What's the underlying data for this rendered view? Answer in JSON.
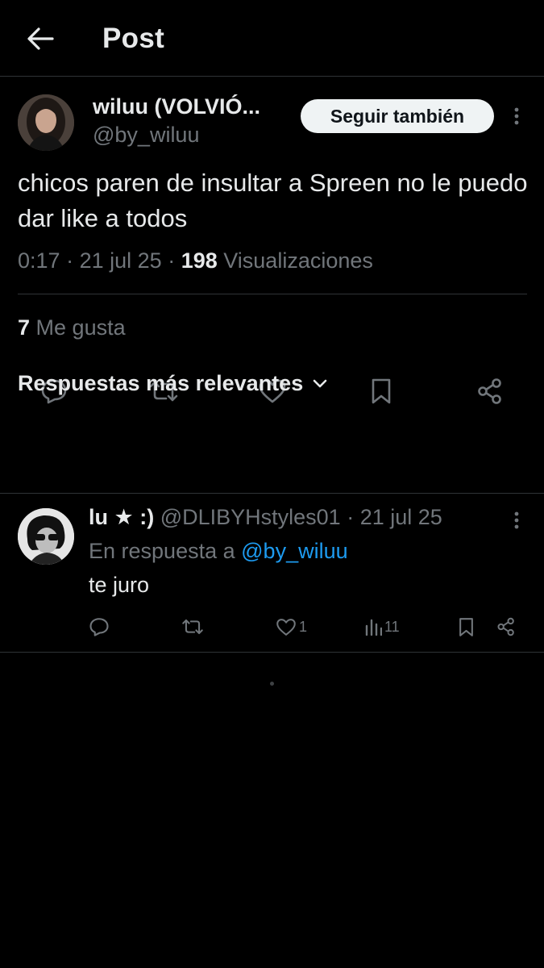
{
  "header": {
    "title": "Post"
  },
  "post": {
    "author_name": "wiluu (VOLVIÓ...",
    "author_handle": "@by_wiluu",
    "follow_label": "Seguir también",
    "text": "chicos paren de insultar a Spreen no le puedo dar like a todos",
    "time": "0:17",
    "date": "21 jul 25",
    "views_count": "198",
    "views_label": "Visualizaciones",
    "likes_count": "7",
    "likes_label": "Me gusta"
  },
  "actions": {
    "reply_icon": "reply-icon",
    "retweet_icon": "retweet-icon",
    "like_icon": "heart-icon",
    "bookmark_icon": "bookmark-icon",
    "share_icon": "share-icon"
  },
  "replies": {
    "sort_label": "Respuestas más relevantes",
    "items": [
      {
        "name": "lu ★ :)",
        "handle": "@DLIBYHstyles01",
        "date": "21 jul 25",
        "reply_to_prefix": "En respuesta a",
        "reply_to_handle": "@by_wiluu",
        "text": "te juro",
        "likes": "1",
        "views": "11"
      }
    ]
  },
  "colors": {
    "background": "#000000",
    "text_primary": "#e7e9ea",
    "text_secondary": "#71767b",
    "accent": "#1d9bf0",
    "divider": "#2f3336",
    "follow_button_bg": "#eff3f4"
  }
}
